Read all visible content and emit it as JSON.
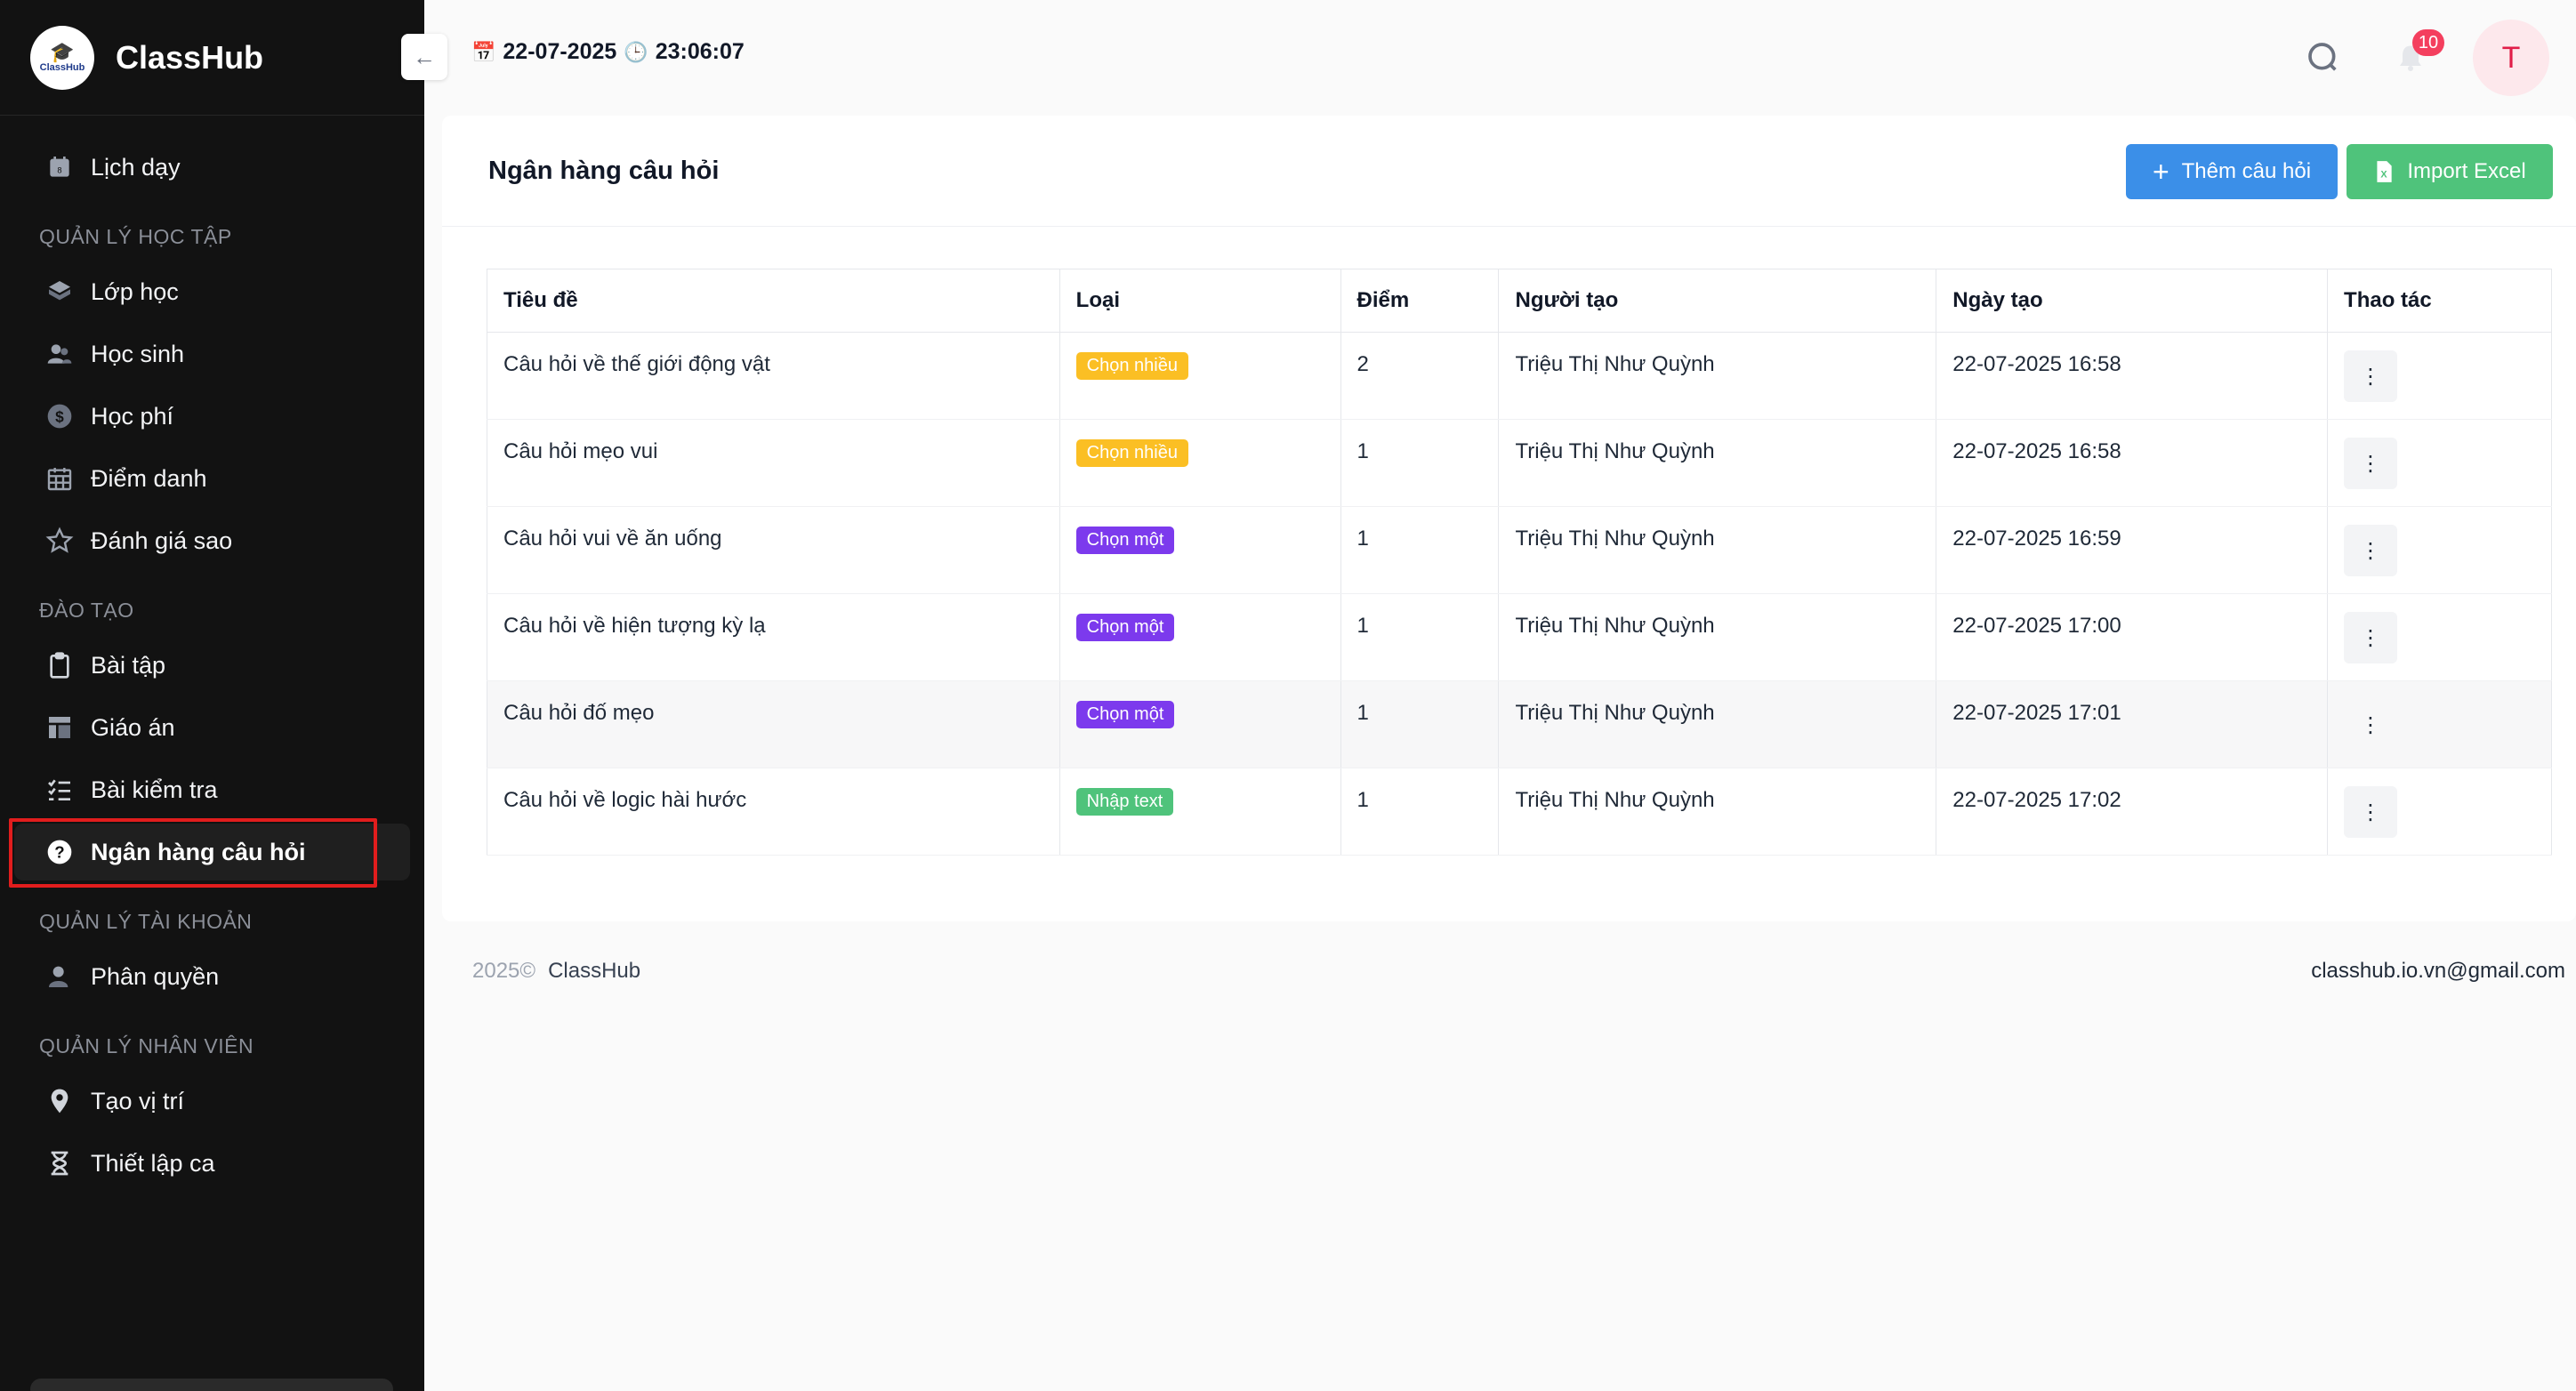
{
  "app": {
    "name": "ClassHub",
    "logo_text": "ClassHub"
  },
  "sidebar": {
    "top_item": {
      "label": "Lịch dạy",
      "icon": "calendar-icon"
    },
    "sections": [
      {
        "title": "QUẢN LÝ HỌC TẬP",
        "items": [
          {
            "label": "Lớp học",
            "icon": "cube-icon"
          },
          {
            "label": "Học sinh",
            "icon": "users-icon"
          },
          {
            "label": "Học phí",
            "icon": "dollar-icon"
          },
          {
            "label": "Điểm danh",
            "icon": "calendar-grid-icon"
          },
          {
            "label": "Đánh giá sao",
            "icon": "star-icon"
          }
        ]
      },
      {
        "title": "ĐÀO TẠO",
        "items": [
          {
            "label": "Bài tập",
            "icon": "clipboard-icon"
          },
          {
            "label": "Giáo án",
            "icon": "layout-icon"
          },
          {
            "label": "Bài kiểm tra",
            "icon": "checklist-icon"
          },
          {
            "label": "Ngân hàng câu hỏi",
            "icon": "question-icon",
            "active": true
          }
        ]
      },
      {
        "title": "QUẢN LÝ TÀI KHOẢN",
        "items": [
          {
            "label": "Phân quyền",
            "icon": "user-icon"
          }
        ]
      },
      {
        "title": "QUẢN LÝ NHÂN VIÊN",
        "items": [
          {
            "label": "Tạo vị trí",
            "icon": "location-pin-icon"
          },
          {
            "label": "Thiết lập ca",
            "icon": "hourglass-icon"
          }
        ]
      }
    ]
  },
  "topbar": {
    "date": "22-07-2025",
    "time": "23:06:07",
    "notification_count": "10",
    "avatar_initial": "T"
  },
  "page": {
    "title": "Ngân hàng câu hỏi",
    "add_button": "Thêm câu hỏi",
    "import_button": "Import Excel"
  },
  "table": {
    "headers": [
      "Tiêu đề",
      "Loại",
      "Điểm",
      "Người tạo",
      "Ngày tạo",
      "Thao tác"
    ],
    "rows": [
      {
        "title": "Câu hỏi về thế giới động vật",
        "type": "Chọn nhiều",
        "type_color": "#fbbf24",
        "score": "2",
        "creator": "Triệu Thị Như Quỳnh",
        "created": "22-07-2025 16:58"
      },
      {
        "title": "Câu hỏi mẹo vui",
        "type": "Chọn nhiều",
        "type_color": "#fbbf24",
        "score": "1",
        "creator": "Triệu Thị Như Quỳnh",
        "created": "22-07-2025 16:58"
      },
      {
        "title": "Câu hỏi vui về ăn uống",
        "type": "Chọn một",
        "type_color": "#7c3aed",
        "score": "1",
        "creator": "Triệu Thị Như Quỳnh",
        "created": "22-07-2025 16:59"
      },
      {
        "title": "Câu hỏi về hiện tượng kỳ lạ",
        "type": "Chọn một",
        "type_color": "#7c3aed",
        "score": "1",
        "creator": "Triệu Thị Như Quỳnh",
        "created": "22-07-2025 17:00"
      },
      {
        "title": "Câu hỏi đố mẹo",
        "type": "Chọn một",
        "type_color": "#7c3aed",
        "score": "1",
        "creator": "Triệu Thị Như Quỳnh",
        "created": "22-07-2025 17:01"
      },
      {
        "title": "Câu hỏi về logic hài hước",
        "type": "Nhập text",
        "type_color": "#4fc37b",
        "score": "1",
        "creator": "Triệu Thị Như Quỳnh",
        "created": "22-07-2025 17:02"
      }
    ]
  },
  "footer": {
    "year": "2025©",
    "brand": "ClassHub",
    "email": "classhub.io.vn@gmail.com"
  }
}
